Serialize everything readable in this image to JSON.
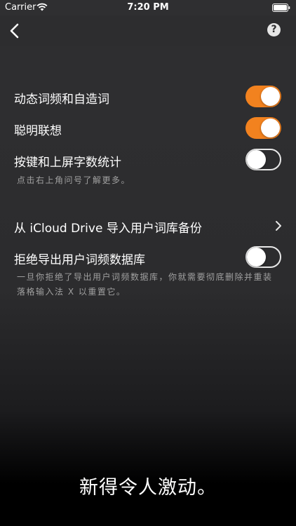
{
  "status_bar": {
    "carrier": "Carrier",
    "time": "7:20 PM"
  },
  "nav": {
    "back_icon": "chevron-left-icon",
    "help_label": "?"
  },
  "settings": {
    "dynamic_freq": {
      "label": "动态词频和自造词",
      "enabled": true
    },
    "smart_assoc": {
      "label": "聪明联想",
      "enabled": true
    },
    "key_stats": {
      "label": "按键和上屏字数统计",
      "enabled": false
    },
    "help_note": "点击右上角问号了解更多。",
    "icloud_import": {
      "label": "从 iCloud Drive 导入用户词库备份"
    },
    "refuse_export": {
      "label": "拒绝导出用户词频数据库",
      "enabled": false
    },
    "refuse_note": "一旦你拒绝了导出用户词频数据库，你就需要彻底删除并重装落格输入法 X 以重置它。"
  },
  "caption": "新得令人激动。",
  "colors": {
    "accent": "#f2821f",
    "background": "#2c2c2e",
    "footnote": "#a0a0a0"
  }
}
